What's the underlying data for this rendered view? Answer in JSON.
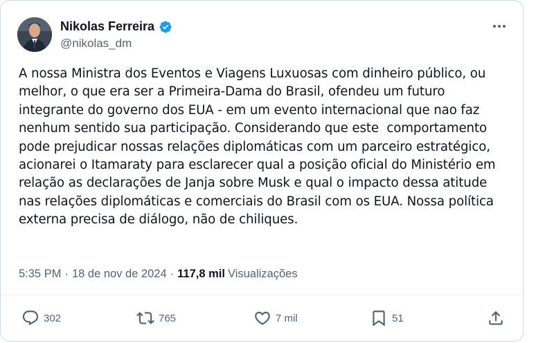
{
  "author": {
    "name": "Nikolas Ferreira",
    "handle": "@nikolas_dm",
    "verified": true,
    "verified_color": "#1d9bf0"
  },
  "post": {
    "text": "A nossa Ministra dos Eventos e Viagens Luxuosas com dinheiro público, ou melhor, o que era ser a Primeira-Dama do Brasil, ofendeu um futuro integrante do governo dos EUA - em um evento internacional que nao faz nenhum sentido sua participação. Considerando que este  comportamento pode prejudicar nossas relações diplomáticas com um parceiro estratégico, acionarei o Itamaraty para esclarecer qual a posição oficial do Ministério em relação as declarações de Janja sobre Musk e qual o impacto dessa atitude nas relações diplomáticas e comerciais do Brasil com os EUA. Nossa política externa precisa de diálogo, não de chiliques.",
    "time": "5:35 PM",
    "separator": "·",
    "date": "18 de nov de 2024",
    "views_count": "117,8 mil",
    "views_label": "Visualizações"
  },
  "actions": {
    "replies": "302",
    "reposts": "765",
    "likes": "7 mil",
    "bookmarks": "51"
  },
  "icons": {
    "more": "more-icon",
    "reply": "reply-icon",
    "repost": "repost-icon",
    "like": "heart-icon",
    "bookmark": "bookmark-icon",
    "share": "share-icon"
  },
  "colors": {
    "text": "#0f1419",
    "secondary": "#536471",
    "border": "#cfd9de"
  }
}
